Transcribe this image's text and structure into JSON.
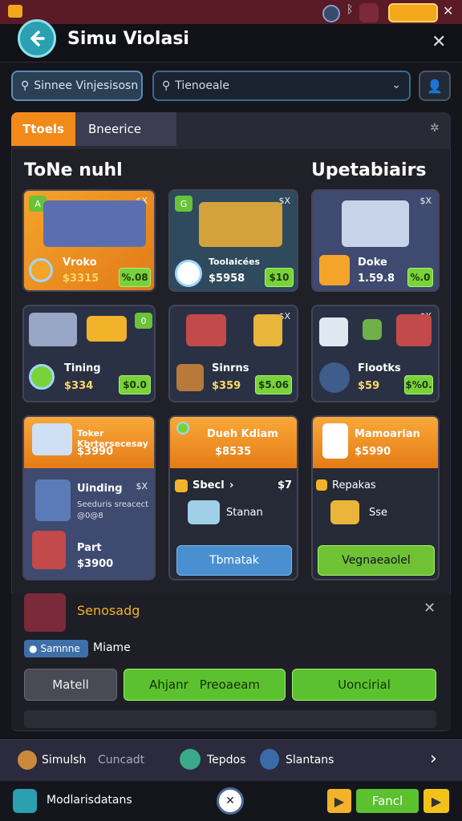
{
  "header": {
    "title": "Simu Violasi"
  },
  "search": {
    "chip_label": "Sinnee Vinjesisosn",
    "placeholder": "Tienoeale"
  },
  "tabs": [
    {
      "label": "Ttoels"
    },
    {
      "label": "Bneerice"
    }
  ],
  "sections": {
    "left_title": "ToNe nuhl",
    "right_title": "Upetabiairs"
  },
  "cards_row1": [
    {
      "name": "Vroko",
      "price": "$3315",
      "button": "%.08",
      "badge": "A",
      "corner": "$X"
    },
    {
      "name": "Toolaicées",
      "price": "$5958",
      "button": "$10",
      "badge": "G",
      "corner": "$X"
    },
    {
      "name": "Doke",
      "price": "1.59.8",
      "button": "%.0",
      "badge": "",
      "corner": "$X"
    }
  ],
  "cards_row2": [
    {
      "name": "Tining",
      "price": "$334",
      "button": "$0.0",
      "badge": "0"
    },
    {
      "name": "Sinrns",
      "price": "$359",
      "button": "$5.06",
      "corner": "$X"
    },
    {
      "name": "Flootks",
      "price": "$59",
      "button": "$%0.",
      "corner": "$X"
    }
  ],
  "cards_row3": [
    {
      "header_title": "Toker Kbrtersecesay",
      "header_price": "$3990",
      "sub_title": "Uinding",
      "sub_corner": "$X",
      "sub_desc": "Seeduris sreacect",
      "sub_desc2": "@0@8",
      "item_name": "Part",
      "item_price": "$3900"
    },
    {
      "header_title": "Dueh Kdiam",
      "header_price": "$8535",
      "row_label": "Sbecl",
      "row_value": "$7",
      "item_name": "Stanan",
      "button": "Tbmatak"
    },
    {
      "header_title": "Mamoarian",
      "header_price": "$5990",
      "row_label": "Repakas",
      "item_name": "Sse",
      "button": "Vegnaeaolel"
    }
  ],
  "notification": {
    "title": "Senosadg",
    "tag": "Samnne",
    "tag_text": "Miame",
    "buttons": [
      "Matell",
      "Ahjanr",
      "Uoncirial"
    ],
    "button2_badge": "Preoaeam"
  },
  "bottom_nav": {
    "items": [
      {
        "label": "Simulsh",
        "sub": "Cuncadt"
      },
      {
        "label": "Tepdos"
      },
      {
        "label": "Slantans"
      }
    ]
  },
  "footer": {
    "label": "Modlarisdatans",
    "fancy": "Fancl"
  },
  "colors": {
    "accent_orange": "#f28a1a",
    "accent_green": "#7ad23b",
    "accent_teal": "#2aa0b0",
    "accent_blue": "#4a8fd0"
  }
}
